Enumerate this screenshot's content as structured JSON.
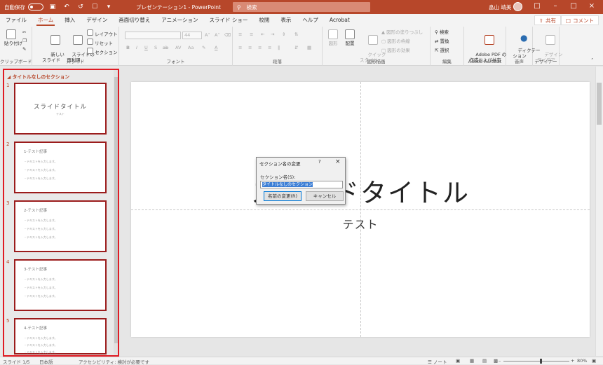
{
  "titlebar": {
    "autosave_label": "自動保存",
    "autosave_state": "オフ",
    "doc_title": "プレゼンテーション1 - PowerPoint",
    "search_placeholder": "検索",
    "user_name": "畠山 靖美"
  },
  "tabs": [
    "ファイル",
    "ホーム",
    "挿入",
    "デザイン",
    "画面切り替え",
    "アニメーション",
    "スライド ショー",
    "校閲",
    "表示",
    "ヘルプ",
    "Acrobat"
  ],
  "active_tab": "ホーム",
  "share_label": "共有",
  "comment_label": "コメント",
  "ribbon": {
    "clipboard": {
      "paste": "貼り付け",
      "label": "クリップボード"
    },
    "slides": {
      "new_slide": "新しい\nスライド",
      "reuse": "スライドの\n再利用",
      "layout": "レイアウト",
      "reset": "リセット",
      "section": "セクション",
      "label": "スライド"
    },
    "font": {
      "size": "44",
      "label": "フォント"
    },
    "paragraph": {
      "label": "段落"
    },
    "drawing": {
      "shapes": "図形",
      "arrange": "配置",
      "quick_styles": "クイック\nスタイル",
      "fill": "図形の塗りつぶし",
      "outline": "図形の枠線",
      "effects": "図形の効果",
      "label": "図形描画"
    },
    "editing": {
      "find": "検索",
      "replace": "置換",
      "select": "選択",
      "label": "編集"
    },
    "acrobat": {
      "create_pdf": "Adobe PDF の\n作成および共有",
      "label": "Adobe Acrobat"
    },
    "voice": {
      "dictate": "ディクテー\nション",
      "label": "音声"
    },
    "designer": {
      "design_ideas": "デザイン\nアイデア",
      "label": "デザイナー"
    }
  },
  "left_pane": {
    "section_title": "タイトルなしのセクション",
    "slides": [
      {
        "num": "1",
        "type": "title",
        "title": "スライドタイトル",
        "sub": "テスト"
      },
      {
        "num": "2",
        "type": "content",
        "heading": "1-テスト記事",
        "lines": [
          "・テキストを入力します。",
          "・テキストを入力します。",
          "・テキストを入力します。"
        ]
      },
      {
        "num": "3",
        "type": "content",
        "heading": "2-テスト記事",
        "lines": [
          "・テキストを入力します。",
          "・テキストを入力します。",
          "・テキストを入力します。"
        ]
      },
      {
        "num": "4",
        "type": "content",
        "heading": "3-テスト記事",
        "lines": [
          "・テキストを入力します。",
          "・テキストを入力します。",
          "・テキストを入力します。"
        ]
      },
      {
        "num": "5",
        "type": "content",
        "heading": "4-テスト記事",
        "lines": [
          "・テキストを入力します。",
          "・テキストを入力します。",
          "・テキストを入力します。"
        ]
      }
    ]
  },
  "slide": {
    "title": "スライドタイトル",
    "subtitle": "テスト"
  },
  "dialog": {
    "title": "セクション名の変更",
    "help": "?",
    "close": "×",
    "field_label": "セクション名(S):",
    "field_value": "タイトルなしのセクション",
    "rename_button": "名前の変更(R)",
    "cancel_button": "キャンセル"
  },
  "statusbar": {
    "slide_info": "スライド 1/5",
    "language": "日本語",
    "accessibility": "アクセシビリティ: 検討が必要です",
    "notes": "ノート",
    "zoom": "80%"
  }
}
